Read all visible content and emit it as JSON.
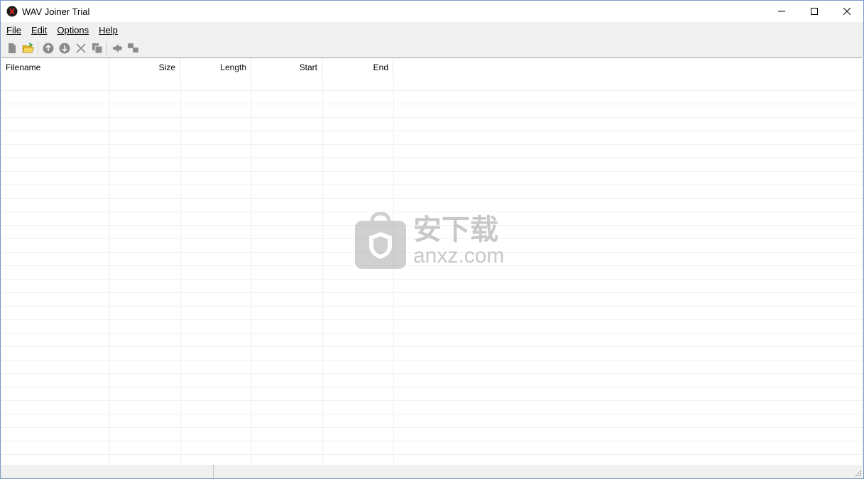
{
  "window": {
    "title": "WAV Joiner Trial",
    "icon": "app-icon",
    "controls": [
      "minimize-icon",
      "maximize-icon",
      "close-icon"
    ]
  },
  "menu": {
    "items": [
      {
        "label": "File",
        "underline": "F"
      },
      {
        "label": "Edit",
        "underline": "E"
      },
      {
        "label": "Options",
        "underline": "O"
      },
      {
        "label": "Help",
        "underline": "H"
      }
    ]
  },
  "toolbar": {
    "buttons": [
      {
        "icon": "new-file-icon",
        "enabled": false
      },
      {
        "icon": "open-folder-icon",
        "enabled": true
      },
      {
        "icon": "move-up-icon",
        "enabled": false
      },
      {
        "icon": "move-down-icon",
        "enabled": false
      },
      {
        "icon": "delete-icon",
        "enabled": false
      },
      {
        "icon": "copy-icon",
        "enabled": false
      },
      {
        "icon": "play-icon",
        "enabled": false
      },
      {
        "icon": "join-icon",
        "enabled": false
      }
    ]
  },
  "list": {
    "columns": [
      {
        "key": "filename",
        "label": "Filename"
      },
      {
        "key": "size",
        "label": "Size"
      },
      {
        "key": "length",
        "label": "Length"
      },
      {
        "key": "start",
        "label": "Start"
      },
      {
        "key": "end",
        "label": "End"
      }
    ],
    "rows": []
  },
  "watermark": {
    "cn": "安下载",
    "en": "anxz.com"
  },
  "colors": {
    "accent_folder": "#f2c12e",
    "disabled_icon": "#8c8c8c",
    "border": "#7a9cc7"
  }
}
